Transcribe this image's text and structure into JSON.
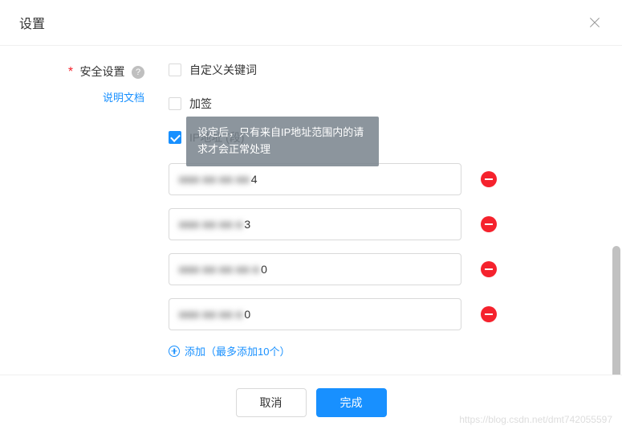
{
  "dialog": {
    "title": "设置"
  },
  "section": {
    "label": "安全设置",
    "doc_link": "说明文档"
  },
  "checkboxes": {
    "custom_keyword": {
      "label": "自定义关键词",
      "checked": false
    },
    "signature": {
      "label": "加签",
      "checked": false
    },
    "ip_range": {
      "label": "IP地址 (段)",
      "checked": true
    }
  },
  "tooltip": {
    "text": "设定后，只有来自IP地址范围内的请求才会正常处理"
  },
  "ip_inputs": [
    {
      "masked": "■■■ ■■ ■■ ■■",
      "visible": "4"
    },
    {
      "masked": "■■■ ■■ ■■ ■",
      "visible": "3"
    },
    {
      "masked": "■■■ ■■ ■■ ■■ ■",
      "visible": "0"
    },
    {
      "masked": "■■■ ■■ ■■ ■",
      "visible": "0"
    }
  ],
  "add_link": {
    "text": "添加（最多添加10个）"
  },
  "footer": {
    "cancel": "取消",
    "confirm": "完成"
  },
  "watermark": "https://blog.csdn.net/dmt742055597"
}
